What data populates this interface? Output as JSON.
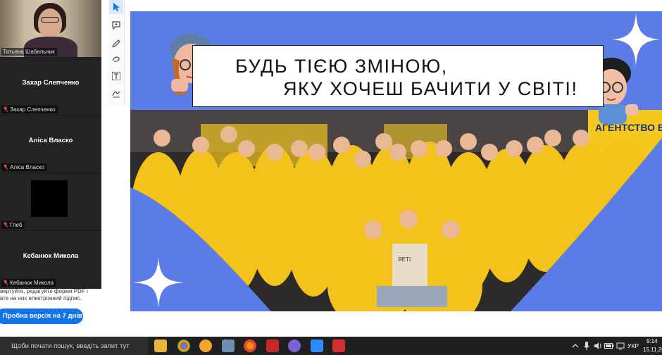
{
  "zoom": {
    "presenter_name": "Татьяна Шабельник",
    "participants": [
      {
        "display_name": "Захар Слепченко",
        "caption": "Захар Слепченко"
      },
      {
        "display_name": "Аліса Власко",
        "caption": "Аліса Власко"
      },
      {
        "display_name": "",
        "caption": "Глеб"
      },
      {
        "display_name": "Кебанюк Микола",
        "caption": "Кебанюк Микола"
      }
    ]
  },
  "pdf_app": {
    "promo_line1": "вертуйте, редагуйте форми PDF і",
    "promo_line2": "вте на них електронний підпис.",
    "trial_button": "Пробна версія на 7 днів"
  },
  "slide": {
    "title_line1": "БУДЬ ТІЄЮ ЗМІНОЮ,",
    "title_line2": "ЯКУ ХОЧЕШ БАЧИТИ У СВІТІ!",
    "banner_text": "АГЕНТСТВО ВОЛОНТЕРСТВА",
    "shirt_text": "ЯЕТІ",
    "colors": {
      "background": "#5b7ce6",
      "jacket": "#f3c21b",
      "banner": "#f4c81f"
    }
  },
  "taskbar": {
    "search_placeholder": "Щоби почати пошук, введіть запит тут",
    "language": "УКР",
    "time": "9:14",
    "date": "15.11.20"
  }
}
